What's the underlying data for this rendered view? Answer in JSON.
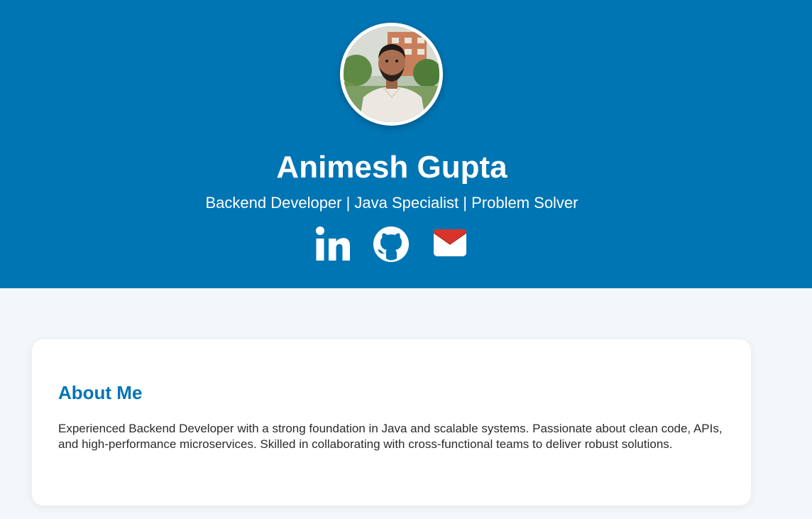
{
  "profile": {
    "name": "Animesh Gupta",
    "tagline": "Backend Developer | Java Specialist | Problem Solver"
  },
  "social": {
    "items": [
      {
        "icon": "linkedin-icon",
        "color": "#ffffff"
      },
      {
        "icon": "github-icon",
        "color": "#ffffff"
      },
      {
        "icon": "mail-icon",
        "color": "#d9342b"
      }
    ]
  },
  "about": {
    "title": "About Me",
    "text": "Experienced Backend Developer with a strong foundation in Java and scalable systems. Passionate about clean code, APIs, and high-performance microservices. Skilled in collaborating with cross-functional teams to deliver robust solutions."
  },
  "colors": {
    "brand": "#0075b4",
    "page_background": "#f4f7fa",
    "card_background": "#ffffff",
    "text": "#2b2b2b"
  }
}
